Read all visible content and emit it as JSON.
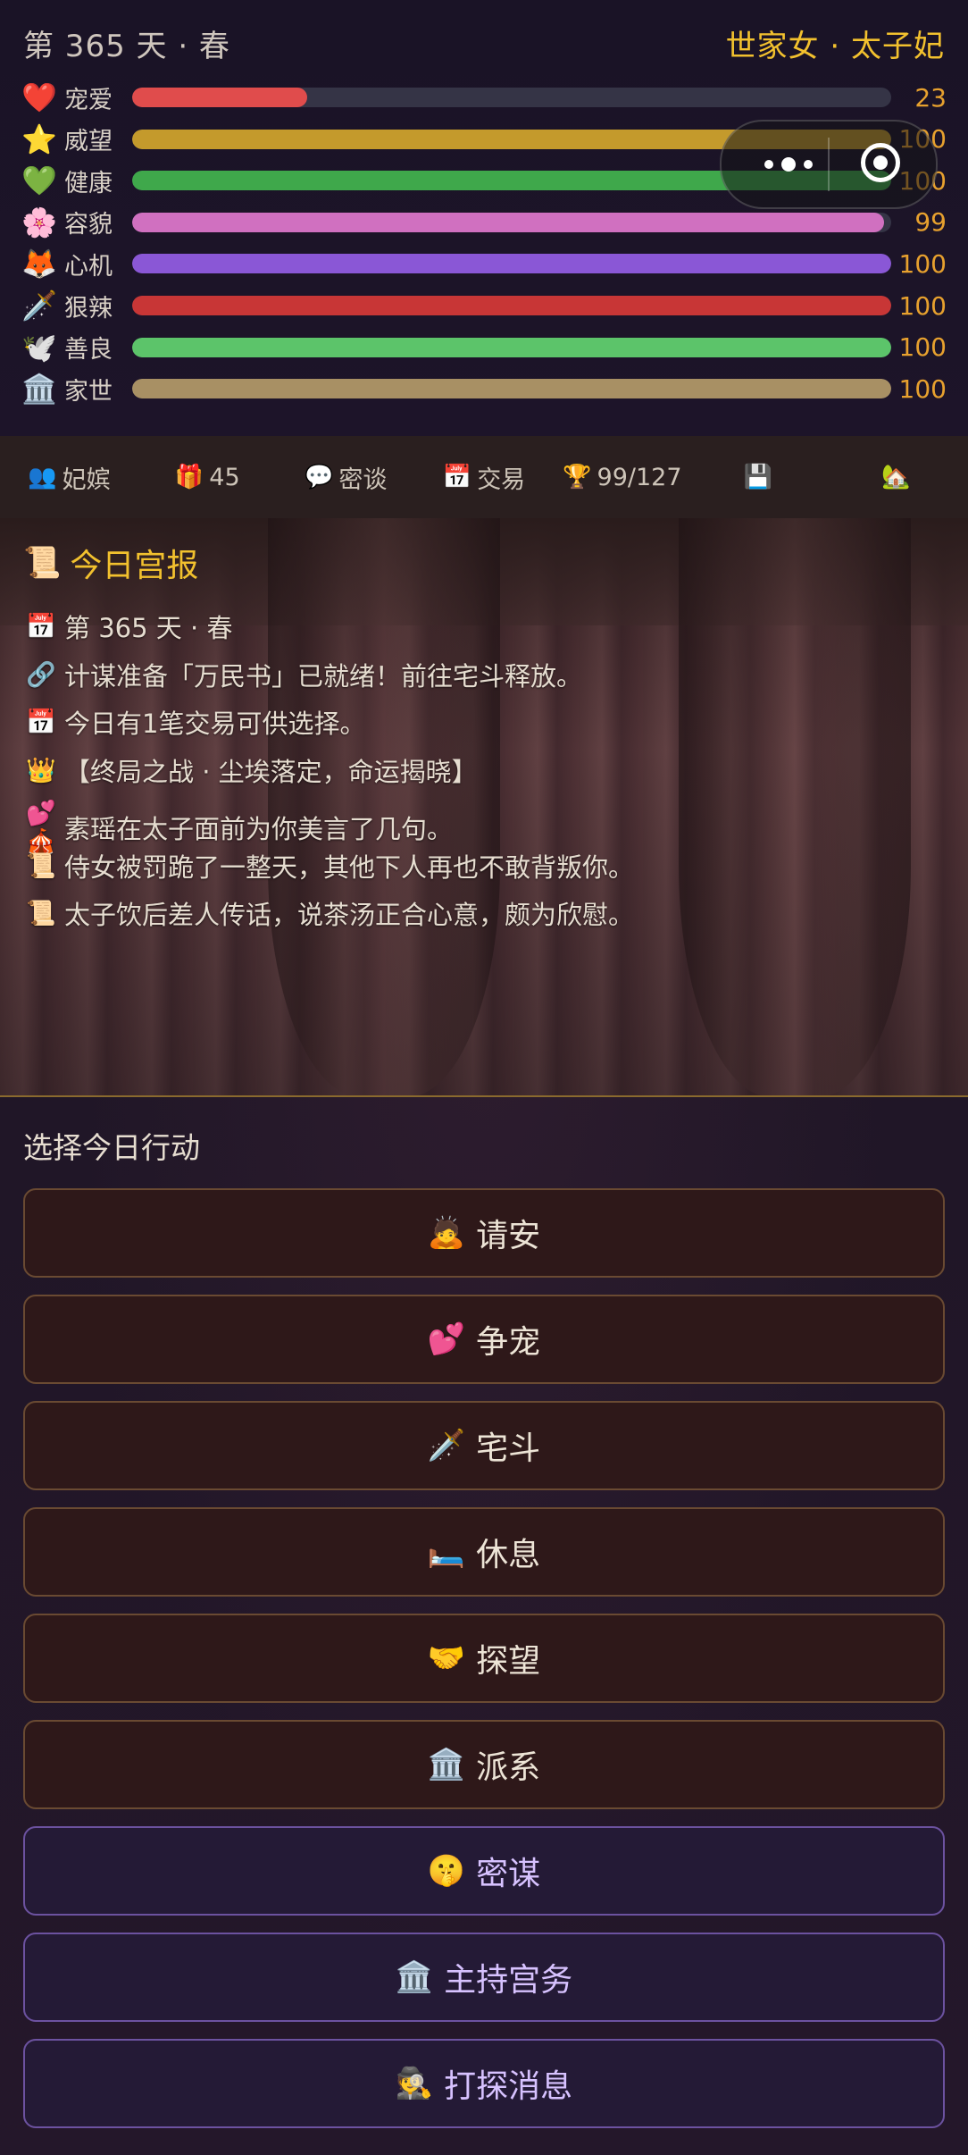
{
  "header": {
    "day_text": "第 365 天 · 春",
    "identity": "世家女 · 太子妃"
  },
  "stats": [
    {
      "icon": "heart-icon",
      "glyph": "❤️",
      "label": "宠爱",
      "value": "23",
      "percent": 23,
      "color": "#e04c4c"
    },
    {
      "icon": "star-icon",
      "glyph": "⭐",
      "label": "威望",
      "value": "100",
      "percent": 100,
      "color": "#c49a2c"
    },
    {
      "icon": "green-heart-icon",
      "glyph": "💚",
      "label": "健康",
      "value": "100",
      "percent": 100,
      "color": "#3fa84b"
    },
    {
      "icon": "flower-icon",
      "glyph": "🌸",
      "label": "容貌",
      "value": "99",
      "percent": 99,
      "color": "#d070c0"
    },
    {
      "icon": "fox-icon",
      "glyph": "🦊",
      "label": "心机",
      "value": "100",
      "percent": 100,
      "color": "#8a57d6"
    },
    {
      "icon": "dagger-icon",
      "glyph": "🗡️",
      "label": "狠辣",
      "value": "100",
      "percent": 100,
      "color": "#c83636"
    },
    {
      "icon": "dove-icon",
      "glyph": "🕊️",
      "label": "善良",
      "value": "100",
      "percent": 100,
      "color": "#5cc46a"
    },
    {
      "icon": "temple-icon",
      "glyph": "🏛️",
      "label": "家世",
      "value": "100",
      "percent": 100,
      "color": "#a89064"
    }
  ],
  "nav": [
    {
      "name": "nav-consorts",
      "icon": "people-icon",
      "glyph": "👥",
      "label": "妃嫔"
    },
    {
      "name": "nav-gifts",
      "icon": "gift-icon",
      "glyph": "🎁",
      "label": "45"
    },
    {
      "name": "nav-secret-talk",
      "icon": "speech-bubble-icon",
      "glyph": "💬",
      "label": "密谈"
    },
    {
      "name": "nav-trade",
      "icon": "calendar-24-icon",
      "glyph": "📅",
      "label": "交易"
    },
    {
      "name": "nav-achievements",
      "icon": "trophy-icon",
      "glyph": "🏆",
      "label": "99/127"
    },
    {
      "name": "nav-save",
      "icon": "floppy-disk-icon",
      "glyph": "💾",
      "label": ""
    },
    {
      "name": "nav-home",
      "icon": "house-icon",
      "glyph": "🏡",
      "label": ""
    }
  ],
  "report": {
    "title": "今日宫报",
    "title_glyph": "📜",
    "lines": [
      {
        "icon": "calendar-icon",
        "glyph": "📅",
        "text": "第 365 天 · 春"
      },
      {
        "icon": "link-icon",
        "glyph": "🔗",
        "text": "计谋准备「万民书」已就绪！前往宅斗释放。"
      },
      {
        "icon": "calendar-24-icon",
        "glyph": "📅",
        "text": "今日有1笔交易可供选择。"
      },
      {
        "icon": "crown-icon",
        "glyph": "👑",
        "text": "【终局之战 · 尘埃落定，命运揭晓】"
      },
      {
        "icon": "hearts-tent-icon",
        "glyph": "💕🎪",
        "text": "素瑶在太子面前为你美言了几句。"
      },
      {
        "icon": "scroll-icon",
        "glyph": "📜",
        "text": "侍女被罚跪了一整天，其他下人再也不敢背叛你。"
      },
      {
        "icon": "scroll-icon",
        "glyph": "📜",
        "text": "太子饮后差人传话，说茶汤正合心意，颇为欣慰。"
      }
    ]
  },
  "actions": {
    "title": "选择今日行动",
    "items": [
      {
        "name": "action-greet-button",
        "icon": "bowing-person-icon",
        "glyph": "🙇",
        "label": "请安",
        "style": "brown"
      },
      {
        "name": "action-compete-favor-button",
        "icon": "two-hearts-icon",
        "glyph": "💕",
        "label": "争宠",
        "style": "brown"
      },
      {
        "name": "action-household-fight-button",
        "icon": "dagger-icon",
        "glyph": "🗡️",
        "label": "宅斗",
        "style": "brown"
      },
      {
        "name": "action-rest-button",
        "icon": "bed-icon",
        "glyph": "🛏️",
        "label": "休息",
        "style": "brown"
      },
      {
        "name": "action-visit-button",
        "icon": "handshake-icon",
        "glyph": "🤝",
        "label": "探望",
        "style": "brown"
      },
      {
        "name": "action-faction-button",
        "icon": "temple-icon",
        "glyph": "🏛️",
        "label": "派系",
        "style": "brown"
      },
      {
        "name": "action-conspire-button",
        "icon": "shushing-face-icon",
        "glyph": "🤫",
        "label": "密谋",
        "style": "purple"
      },
      {
        "name": "action-palace-affairs-button",
        "icon": "temple-icon",
        "glyph": "🏛️",
        "label": "主持宫务",
        "style": "purple"
      },
      {
        "name": "action-scout-news-button",
        "icon": "detective-icon",
        "glyph": "🕵️",
        "label": "打探消息",
        "style": "purple"
      }
    ]
  }
}
